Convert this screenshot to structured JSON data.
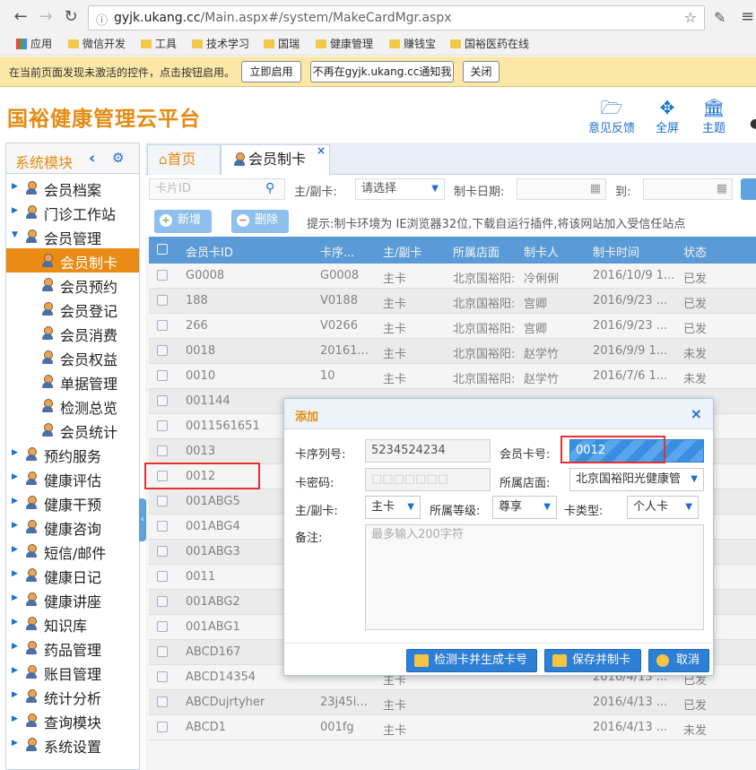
{
  "browser": {
    "url_host": "gyjk.ukang.cc",
    "url_path": "/Main.aspx#/system/MakeCardMgr.aspx",
    "bookmarks": [
      {
        "label": "应用",
        "icon": "apps-grid-icon"
      },
      {
        "label": "微信开发",
        "icon": "folder-icon"
      },
      {
        "label": "工具",
        "icon": "folder-icon"
      },
      {
        "label": "技术学习",
        "icon": "folder-icon"
      },
      {
        "label": "国瑞",
        "icon": "folder-icon"
      },
      {
        "label": "健康管理",
        "icon": "folder-icon"
      },
      {
        "label": "赚钱宝",
        "icon": "folder-icon"
      },
      {
        "label": "国裕医药在线",
        "icon": "folder-icon"
      }
    ]
  },
  "infobar": {
    "message": "在当前页面发现未激活的控件，点击按钮启用。",
    "enable_label": "立即启用",
    "never_label": "不再在gyjk.ukang.cc通知我",
    "close_label": "关闭"
  },
  "header": {
    "title": "国裕健康管理云平台",
    "actions": [
      {
        "label": "意见反馈",
        "icon": "folder-open-icon"
      },
      {
        "label": "全屏",
        "icon": "fullscreen-icon"
      },
      {
        "label": "主题",
        "icon": "bank-icon"
      }
    ]
  },
  "sidebar": {
    "title": "系统模块",
    "items": [
      {
        "label": "会员档案",
        "level": 0,
        "expanded": false,
        "active": false
      },
      {
        "label": "门诊工作站",
        "level": 0,
        "expanded": false,
        "active": false
      },
      {
        "label": "会员管理",
        "level": 0,
        "expanded": true,
        "active": false
      },
      {
        "label": "会员制卡",
        "level": 1,
        "expanded": false,
        "active": true
      },
      {
        "label": "会员预约",
        "level": 1,
        "expanded": false,
        "active": false
      },
      {
        "label": "会员登记",
        "level": 1,
        "expanded": false,
        "active": false
      },
      {
        "label": "会员消费",
        "level": 1,
        "expanded": false,
        "active": false
      },
      {
        "label": "会员权益",
        "level": 1,
        "expanded": false,
        "active": false
      },
      {
        "label": "单据管理",
        "level": 1,
        "expanded": false,
        "active": false
      },
      {
        "label": "检测总览",
        "level": 1,
        "expanded": false,
        "active": false
      },
      {
        "label": "会员统计",
        "level": 1,
        "expanded": false,
        "active": false
      },
      {
        "label": "预约服务",
        "level": 0,
        "expanded": false,
        "active": false
      },
      {
        "label": "健康评估",
        "level": 0,
        "expanded": false,
        "active": false
      },
      {
        "label": "健康干预",
        "level": 0,
        "expanded": false,
        "active": false
      },
      {
        "label": "健康咨询",
        "level": 0,
        "expanded": false,
        "active": false
      },
      {
        "label": "短信/邮件",
        "level": 0,
        "expanded": false,
        "active": false
      },
      {
        "label": "健康日记",
        "level": 0,
        "expanded": false,
        "active": false
      },
      {
        "label": "健康讲座",
        "level": 0,
        "expanded": false,
        "active": false
      },
      {
        "label": "知识库",
        "level": 0,
        "expanded": false,
        "active": false
      },
      {
        "label": "药品管理",
        "level": 0,
        "expanded": false,
        "active": false
      },
      {
        "label": "账目管理",
        "level": 0,
        "expanded": false,
        "active": false
      },
      {
        "label": "统计分析",
        "level": 0,
        "expanded": false,
        "active": false
      },
      {
        "label": "查询模块",
        "level": 0,
        "expanded": false,
        "active": false
      },
      {
        "label": "系统设置",
        "level": 0,
        "expanded": false,
        "active": false
      }
    ]
  },
  "tabs": [
    {
      "label": "首页"
    },
    {
      "label": "会员制卡",
      "close": "×"
    }
  ],
  "filters": {
    "card_id_placeholder": "卡片ID",
    "main_sub_label": "主/副卡:",
    "main_sub_value": "请选择",
    "date_label": "制卡日期:",
    "to_label": "到:"
  },
  "toolbar": {
    "add_label": "新增",
    "delete_label": "删除",
    "tip": "提示:制卡环境为 IE浏览器32位,下载自运行插件,将该网站加入受信任站点"
  },
  "table": {
    "columns": [
      "会员卡ID",
      "卡序...",
      "主/副卡",
      "所属店面",
      "制卡人",
      "制卡时间",
      "状态"
    ],
    "rows": [
      [
        "G0008",
        "G0008",
        "主卡",
        "北京国裕阳:",
        "冷俐俐",
        "2016/10/9 1...",
        "已发"
      ],
      [
        "188",
        "V0188",
        "主卡",
        "北京国裕阳:",
        "宫卿",
        "2016/9/23 ...",
        "已发"
      ],
      [
        "266",
        "V0266",
        "主卡",
        "北京国裕阳:",
        "宫卿",
        "2016/9/23 ...",
        "已发"
      ],
      [
        "0018",
        "20161...",
        "主卡",
        "北京国裕阳:",
        "赵学竹",
        "2016/9/9 1...",
        "未发"
      ],
      [
        "0010",
        "10",
        "主卡",
        "北京国裕阳:",
        "赵学竹",
        "2016/7/6 1...",
        "未发"
      ],
      [
        "001144",
        "",
        "",
        "",
        "",
        "",
        ""
      ],
      [
        "0011561651",
        "",
        "",
        "",
        "",
        "",
        ""
      ],
      [
        "0013",
        "",
        "",
        "",
        "",
        "",
        ""
      ],
      [
        "0012",
        "",
        "",
        "",
        "",
        "",
        ""
      ],
      [
        "001ABG5",
        "",
        "",
        "",
        "",
        "",
        ""
      ],
      [
        "001ABG4",
        "",
        "",
        "",
        "",
        "",
        ""
      ],
      [
        "001ABG3",
        "",
        "",
        "",
        "",
        "",
        ""
      ],
      [
        "0011",
        "",
        "",
        "",
        "",
        "",
        ""
      ],
      [
        "001ABG2",
        "",
        "",
        "",
        "",
        "",
        ""
      ],
      [
        "001ABG1",
        "",
        "",
        "",
        "",
        "",
        ""
      ],
      [
        "ABCD167",
        "",
        "",
        "",
        "",
        "",
        ""
      ],
      [
        "ABCD14354",
        "",
        "主卡",
        "",
        "",
        "2016/4/13 ...",
        "已发"
      ],
      [
        "ABCDujrtyher",
        "23j45i...",
        "主卡",
        "",
        "",
        "2016/4/13 ...",
        "已发"
      ],
      [
        "ABCD1",
        "001fg",
        "主卡",
        "",
        "",
        "2016/4/13 ...",
        "未发"
      ]
    ]
  },
  "dialog": {
    "title": "添加",
    "close": "×",
    "serial_label": "卡序列号:",
    "serial_value": "5234524234",
    "card_no_label": "会员卡号:",
    "card_no_value": "0012",
    "password_label": "卡密码:",
    "password_value": "□□□□□□□",
    "store_label": "所属店面:",
    "store_value": "北京国裕阳光健康管",
    "main_sub_label": "主/副卡:",
    "main_sub_value": "主卡",
    "level_label": "所属等级:",
    "level_value": "尊享",
    "card_type_label": "卡类型:",
    "card_type_value": "个人卡",
    "remark_label": "备注:",
    "remark_placeholder": "最多输入200字符",
    "btn_detect": "检测卡并生成卡号",
    "btn_save": "保存并制卡",
    "btn_cancel": "取消"
  },
  "colors": {
    "accent_orange": "#e58b13",
    "brand_blue": "#1a6fcf",
    "grid_header": "#5ea2e0",
    "highlight_red": "#e53030"
  }
}
